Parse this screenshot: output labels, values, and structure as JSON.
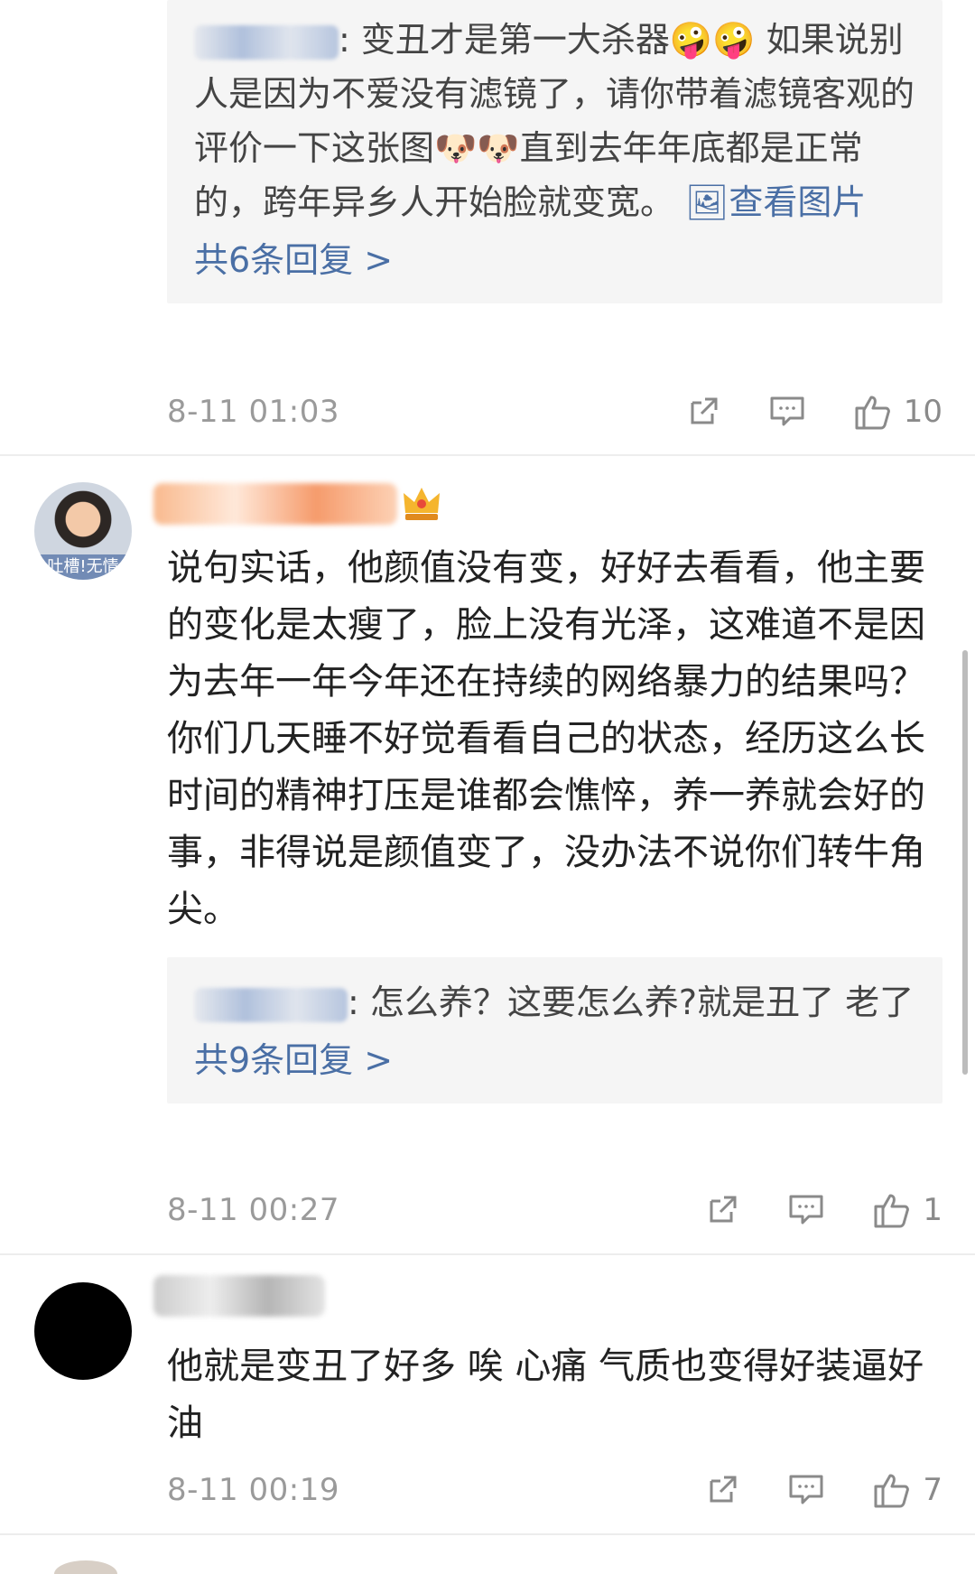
{
  "reply1": {
    "user_prefix": "",
    "text": ": 变丑才是第一大杀器🤪🤪 如果说别人是因为不爱没有滤镜了，请你带着滤镜客观的评价一下这张图🐶🐶直到去年年底都是正常的，跨年异乡人开始脸就变宽。",
    "image_link": "🖼查看图片",
    "more": "共6条回复 >"
  },
  "meta1": {
    "time": "8-11 01:03",
    "likes": "10"
  },
  "comment2": {
    "avatar_caption": "吐槽!无情",
    "text": "说句实话，他颜值没有变，好好去看看，他主要的变化是太瘦了，脸上没有光泽，这难道不是因为去年一年今年还在持续的网络暴力的结果吗？你们几天睡不好觉看看自己的状态，经历这么长时间的精神打压是谁都会憔悴，养一养就会好的事，非得说是颜值变了，没办法不说你们转牛角尖。",
    "reply_text": ": 怎么养？这要怎么养?就是丑了 老了",
    "more": "共9条回复 >",
    "time": "8-11 00:27",
    "likes": "1"
  },
  "comment3": {
    "text": "他就是变丑了好多 唉 心痛  气质也变得好装逼好油",
    "time": "8-11 00:19",
    "likes": "7"
  },
  "colors": {
    "link": "#4a6fa5",
    "meta": "#9a9a9a",
    "reply_bg": "#f5f5f5"
  },
  "icons": [
    "share-icon",
    "comment-icon",
    "like-icon",
    "crown-badge-icon",
    "image-icon"
  ]
}
